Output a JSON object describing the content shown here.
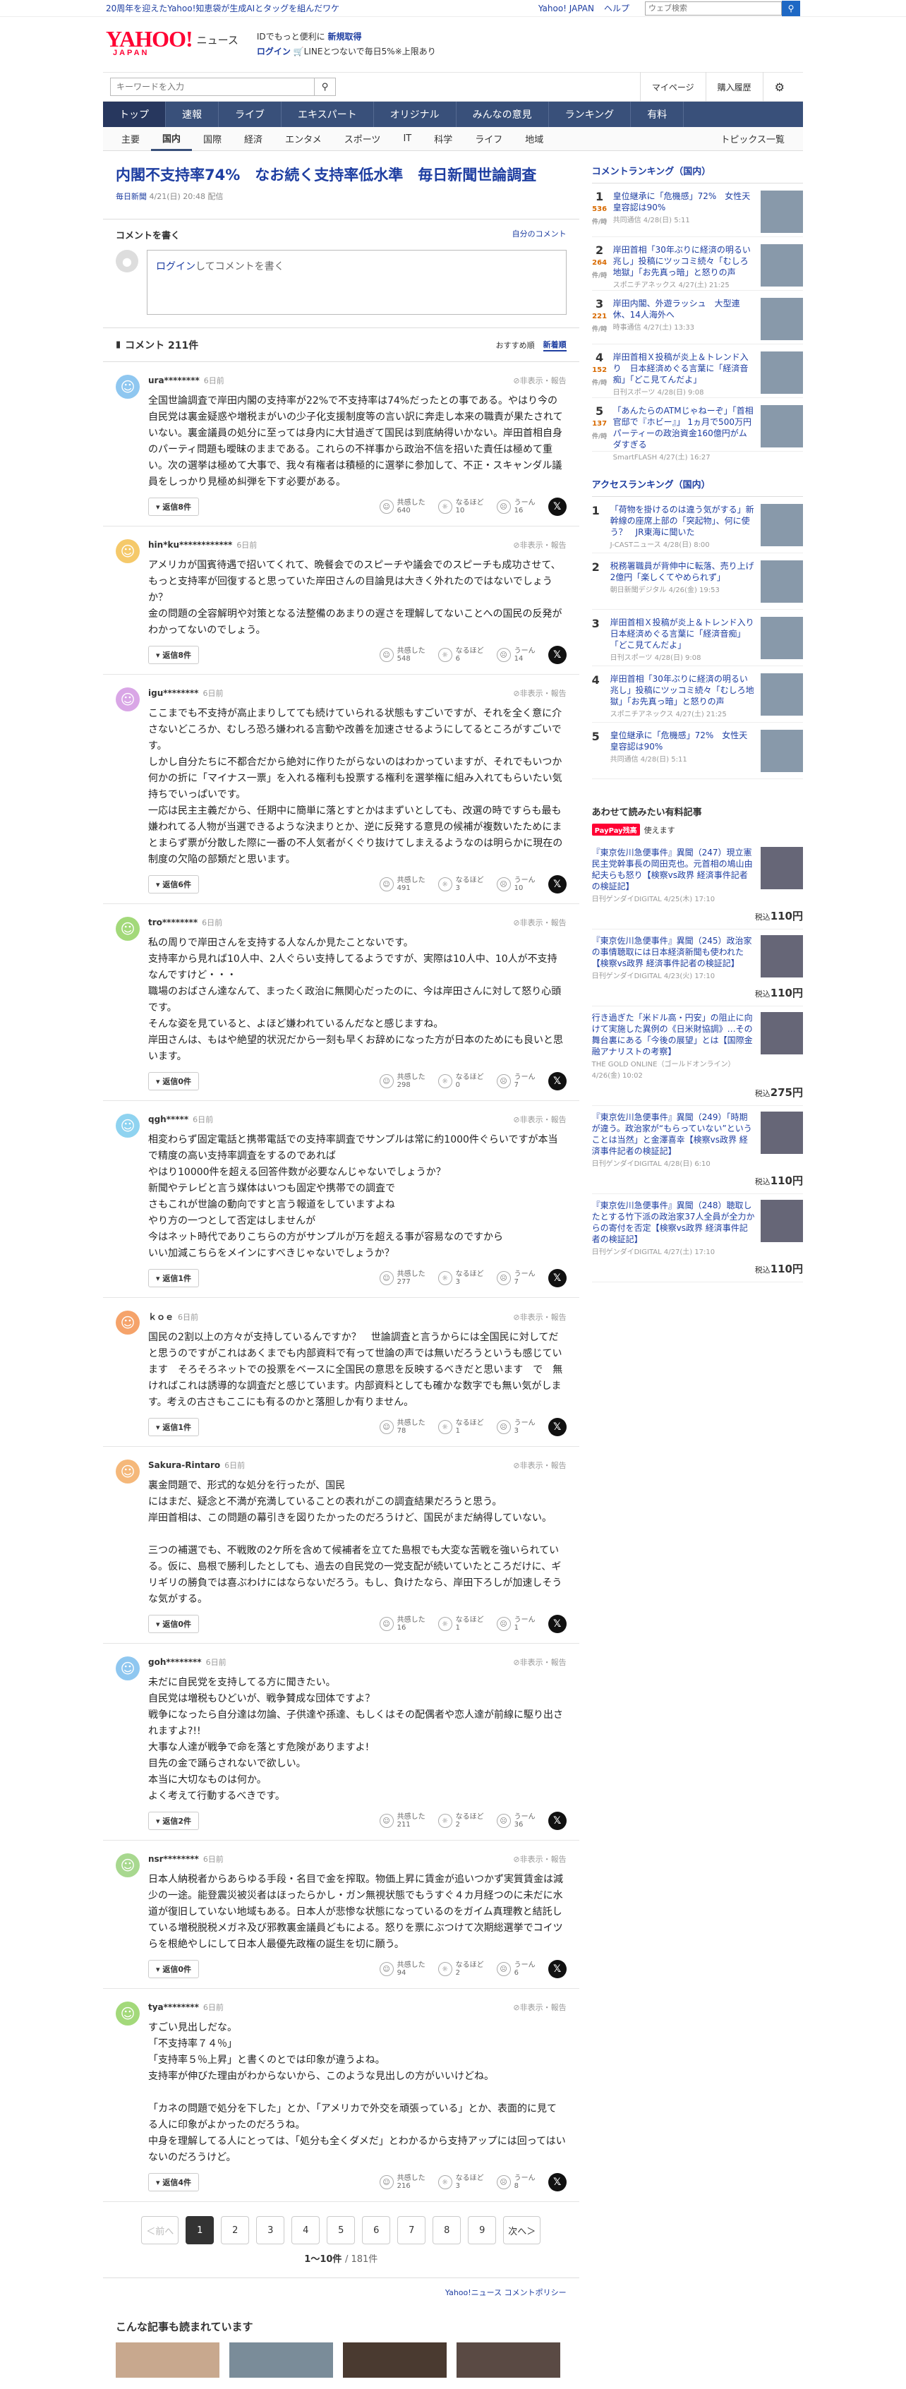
{
  "topbar": {
    "promo": "20周年を迎えたYahoo!知恵袋が生成AIとタッグを組んだワケ",
    "yahoo_japan": "Yahoo! JAPAN",
    "help": "ヘルプ",
    "web_placeholder": "ウェブ検索"
  },
  "header": {
    "logo": "YAHOO!",
    "logo_sub": "JAPAN",
    "site": "ニュース",
    "login_line1_prefix": "IDでもっと便利に",
    "login_line1_link": "新規取得",
    "login_link": "ログイン",
    "login_line2": "LINEとつないで毎日5%※上限あり"
  },
  "search": {
    "placeholder": "キーワードを入力",
    "mypage": "マイページ",
    "history": "購入履歴"
  },
  "nav_main": [
    "トップ",
    "速報",
    "ライブ",
    "エキスパート",
    "オリジナル",
    "みんなの意見",
    "ランキング",
    "有料"
  ],
  "nav_sub": [
    "主要",
    "国内",
    "国際",
    "経済",
    "エンタメ",
    "スポーツ",
    "IT",
    "科学",
    "ライフ",
    "地域"
  ],
  "nav_sub_right": "トピックス一覧",
  "article": {
    "title": "内閣不支持率74%　なお続く支持率低水準　毎日新聞世論調査",
    "source": "毎日新聞",
    "date": "4/21(日) 20:48 配信"
  },
  "comment_box": {
    "title": "コメントを書く",
    "my_comments": "自分のコメント",
    "login_link": "ログイン",
    "input_text": "してコメントを書く"
  },
  "comment_list": {
    "title": "コメント 211件",
    "sort_recommended": "おすすめ順",
    "sort_new": "新着順"
  },
  "labels": {
    "report": "非表示・報告",
    "empathy": "共感した",
    "naruhodo": "なるほど",
    "uun": "うーん"
  },
  "comments": [
    {
      "user": "ura********",
      "date": "6日前",
      "text": "全国世論調査で岸田内閣の支持率が22%で不支持率は74%だったとの事である。やはり今の自民党は裏金疑惑や増税まがいの少子化支援制度等の言い訳に奔走し本来の職責が果たされていない。裏金議員の処分に至っては身内に大甘過ぎて国民は到底納得いかない。岸田首相自身のパーティ問題も曖昧のままである。これらの不祥事から政治不信を招いた責任は極めて重い。次の選挙は極めて大事で、我々有権者は積極的に選挙に参加して、不正・スキャンダル議員をしっかり見極め糾弾を下す必要がある。",
      "replies": "返信8件",
      "e": "640",
      "n": "10",
      "u": "16",
      "color": "#8fc7f0"
    },
    {
      "user": "hin*ku************",
      "date": "6日前",
      "text": "アメリカが国賓待遇で招いてくれて、晩餐会でのスピーチや議会でのスピーチも成功させて、もっと支持率が回復すると思っていた岸田さんの目論見は大きく外れたのではないでしょうか？\n金の問題の全容解明や対策となる法整備のあまりの遅さを理解してないことへの国民の反発がわかってないのでしょう。",
      "replies": "返信8件",
      "e": "548",
      "n": "6",
      "u": "14",
      "color": "#f5c96a"
    },
    {
      "user": "igu********",
      "date": "6日前",
      "text": "ここまでも不支持が高止まりしてても続けていられる状態もすごいですが、それを全く意に介さないどころか、むしろ恐ろ嫌われる言動や改善を加速させるようにしてるところがすごいです。\nしかし自分たちに不都合だから絶対に作りたがらないのはわかっていますが、それでもいつか何かの折に「マイナス一票」を入れる権利も投票する権利を選挙権に組み入れてもらいたい気持ちでいっぱいです。\n一応は民主主義だから、任期中に簡単に落とすとかはまずいとしても、改選の時ですらも最も嫌われてる人物が当選できるような決まりとか、逆に反発する意見の候補が複数いたためにまとまらず票が分散した際に一番の不人気者がくぐり抜けてしまえるようなのは明らかに現在の制度の欠陥の部類だと思います。",
      "replies": "返信6件",
      "e": "491",
      "n": "3",
      "u": "10",
      "color": "#d9a6e6"
    },
    {
      "user": "tro********",
      "date": "6日前",
      "text": "私の周りで岸田さんを支持する人なんか見たことないです。\n支持率から見れば10人中、2人ぐらい支持してるようですが、実際は10人中、10人が不支持なんですけど・・・\n職場のおばさん達なんて、まったく政治に無関心だったのに、今は岸田さんに対して怒り心頭です。\nそんな姿を見ていると、よほど嫌われているんだなと感じますね。\n岸田さんは、もはや絶望的状況だから一刻も早くお辞めになった方が日本のためにも良いと思います。",
      "replies": "返信0件",
      "e": "298",
      "n": "0",
      "u": "7",
      "color": "#a3d97a"
    },
    {
      "user": "qgh*****",
      "date": "6日前",
      "text": "相変わらず固定電話と携帯電話での支持率調査でサンプルは常に約1000件ぐらいですが本当で精度の高い支持率調査をするのであれば\nやはり10000件を超える回答件数が必要なんじゃないでしょうか？\n新聞やテレビと言う媒体はいつも固定や携帯での調査で\nさもこれが世論の動向ですと言う報道をしていますよね\nやり方の一つとして否定はしませんが\n今はネット時代でありこちらの方がサンプルが万を超える事が容易なのですから\nいい加減こちらをメインにすべきじゃないでしょうか？",
      "replies": "返信1件",
      "e": "277",
      "n": "3",
      "u": "7",
      "color": "#8fd3f0"
    },
    {
      "user": "ｋｏｅ",
      "date": "6日前",
      "text": "国民の2割以上の方々が支持しているんですか？　世論調査と言うからには全国民に対してだと思うのですがこれはあくまでも内部資料で有って世論の声では無いだろうというも感じています　そろそろネットでの投票をベースに全国民の意思を反映するべきだと思います　で　無ければこれは誘導的な調査だと感じています。内部資料としても確かな数字でも無い気がします。考えの古さもここにも有るのかと落胆しか有りません。",
      "replies": "返信1件",
      "e": "78",
      "n": "1",
      "u": "3",
      "color": "#f5a36a"
    },
    {
      "user": "Sakura-Rintaro",
      "date": "6日前",
      "text": "裏金問題で、形式的な処分を行ったが、国民\nにはまだ、疑念と不満が充満していることの表れがこの調査結果だろうと思う。\n岸田首相は、この問題の幕引きを図りたかったのだろうけど、国民がまだ納得していない。\n\n三つの補選でも、不戦敗の2ケ所を含めて候補者を立てた島根でも大変な苦戦を強いられている。仮に、島根で勝利したとしても、過去の自民党の一党支配が続いていたところだけに、ギリギリの勝負では喜ぶわけにはならないだろう。もし、負けたなら、岸田下ろしが加速しそうな気がする。",
      "replies": "返信0件",
      "e": "16",
      "n": "1",
      "u": "1",
      "color": "#f5b87a"
    },
    {
      "user": "goh********",
      "date": "6日前",
      "text": "未だに自民党を支持してる方に聞きたい。\n自民党は増税もひどいが、戦争賛成な団体ですよ？\n戦争になったら自分達は勿論、子供達や孫達、もしくはその配偶者や恋人達が前線に駆り出されますよ?!!\n大事な人達が戦争で命を落とす危険がありますよ!\n目先の金で踊らされないで欲しい。\n本当に大切なものは何か。\nよく考えて行動するべきです。",
      "replies": "返信2件",
      "e": "211",
      "n": "2",
      "u": "36",
      "color": "#8fc7f0"
    },
    {
      "user": "nsr********",
      "date": "6日前",
      "text": "日本人納税者からあらゆる手段・名目で金を搾取。物価上昇に賃金が追いつかず実質賃金は減少の一途。能登震災被災者はほったらかし・ガン無視状態でもうすぐ４カ月経つのに未だに水道が復旧していない地域もある。日本人が悲惨な状態になっているのをガイム真理教と結託している増税脱税メガネ及び邪教裏金議員どもによる。怒りを票にぶつけて次期総選挙でコイツらを根絶やしにして日本人最優先政権の誕生を切に願う。",
      "replies": "返信0件",
      "e": "94",
      "n": "2",
      "u": "6",
      "color": "#a8d88f"
    },
    {
      "user": "tya********",
      "date": "6日前",
      "text": "すごい見出しだな。\n「不支持率７４％」\n「支持率５％上昇」と書くのとでは印象が違うよね。\n支持率が伸びた理由がわからないから、このような見出しの方がいいけどね。\n\n「カネの問題で処分を下した」とか、「アメリカで外交を頑張っている」とか、表面的に見てる人に印象がよかったのだろうね。\n中身を理解してる人にとっては、「処分も全くダメだ」とわかるから支持アップには回ってはいないのだろうけど。",
      "replies": "返信4件",
      "e": "216",
      "n": "3",
      "u": "8",
      "color": "#a3d97a"
    }
  ],
  "pager": {
    "prev": "＜前へ",
    "pages": [
      "1",
      "2",
      "3",
      "4",
      "5",
      "6",
      "7",
      "8",
      "9"
    ],
    "next": "次へ＞",
    "count": "1〜10件",
    "total": "/ 181件"
  },
  "policy": "Yahoo!ニュース コメントポリシー",
  "recos_title": "こんな記事も読まれています",
  "ranking": {
    "title": "コメントランキング（国内）",
    "items": [
      {
        "n": "1",
        "c": "536",
        "t": "皇位継承に「危機感」72%　女性天皇容認は90%",
        "s": "共同通信 4/28(日) 5:11"
      },
      {
        "n": "2",
        "c": "264",
        "t": "岸田首相「30年ぶりに経済の明るい兆し」投稿にツッコミ続々「むしろ地獄」「お先真っ暗」と怒りの声",
        "s": "スポニチアネックス 4/27(土) 21:25"
      },
      {
        "n": "3",
        "c": "221",
        "t": "岸田内閣、外遊ラッシュ　大型連休、14人海外へ",
        "s": "時事通信 4/27(土) 13:33"
      },
      {
        "n": "4",
        "c": "152",
        "t": "岸田首相Ｘ投稿が炎上＆トレンド入り　日本経済めぐる言葉に「経済音痴」「どこ見てんだよ」",
        "s": "日刊スポーツ 4/28(日) 9:08"
      },
      {
        "n": "5",
        "c": "137",
        "t": "「あんたらのATMじゃねーぞ」「首相官邸で『ホビー』」 1ヵ月で500万円パーティーの政治資金160億円がムダすぎる",
        "s": "SmartFLASH 4/27(土) 16:27"
      }
    ],
    "unit": "件",
    "sub": "件/時"
  },
  "access": {
    "title": "アクセスランキング（国内）",
    "items": [
      {
        "n": "1",
        "t": "「荷物を掛けるのは違う気がする」新幹線の座席上部の「突起物」、何に使う？　JR東海に聞いた",
        "s": "J-CASTニュース 4/28(日) 8:00"
      },
      {
        "n": "2",
        "t": "税務署職員が背伸中に転落、売り上げ2億円「楽しくてやめられず」",
        "s": "朝日新聞デジタル 4/26(金) 19:53"
      },
      {
        "n": "3",
        "t": "岸田首相Ｘ投稿が炎上＆トレンド入り　日本経済めぐる言葉に「経済音痴」「どこ見てんだよ」",
        "s": "日刊スポーツ 4/28(日) 9:08"
      },
      {
        "n": "4",
        "t": "岸田首相「30年ぶりに経済の明るい兆し」投稿にツッコミ続々「むしろ地獄」「お先真っ暗」と怒りの声",
        "s": "スポニチアネックス 4/27(土) 21:25"
      },
      {
        "n": "5",
        "t": "皇位継承に「危機感」72%　女性天皇容認は90%",
        "s": "共同通信 4/28(日) 5:11"
      }
    ]
  },
  "paid": {
    "title": "あわせて読みたい有料記事",
    "paypay": "PayPay残高",
    "paypay_text": "使えます",
    "price_prefix": "税込",
    "items": [
      {
        "t": "『東京佐川急便事件』異聞（247）現立憲民主党幹事長の岡田克也。元首相の鳩山由紀夫らも怒り【検察vs政界 経済事件記者の検証記】",
        "s": "日刊ゲンダイDIGITAL 4/25(木) 17:10",
        "p": "110円"
      },
      {
        "t": "『東京佐川急便事件』異聞（245）政治家の事情聴取には日本経済新聞も使われた【検察vs政界 経済事件記者の検証記】",
        "s": "日刊ゲンダイDIGITAL 4/23(火) 17:10",
        "p": "110円"
      },
      {
        "t": "行き過ぎた「米ドル高・円安」の阻止に向けて実施した異例の《日米財協調》…その舞台裏にある「今後の展望」とは【国際金融アナリストの考察】",
        "s": "THE GOLD ONLINE（ゴールドオンライン） 4/26(金) 10:02",
        "p": "275円"
      },
      {
        "t": "『東京佐川急便事件』異聞（249）「時期が違う。政治家が“もらっていない”ということは当然」と金澤喜幸【検察vs政界 経済事件記者の検証記】",
        "s": "日刊ゲンダイDIGITAL 4/28(日) 6:10",
        "p": "110円"
      },
      {
        "t": "『東京佐川急便事件』異聞（248）聴取したとする竹下派の政治家37人全員が全力からの寄付を否定【検察vs政界 経済事件記者の検証記】",
        "s": "日刊ゲンダイDIGITAL 4/27(土) 17:10",
        "p": "110円"
      }
    ]
  }
}
